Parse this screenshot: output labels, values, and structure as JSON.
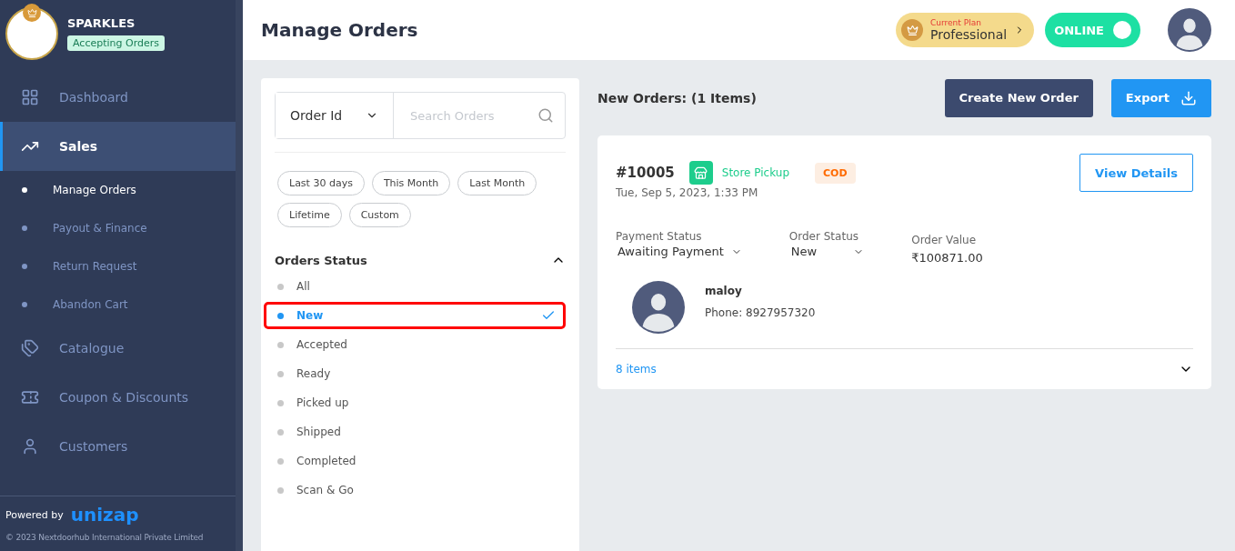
{
  "store": {
    "name": "SPARKLES",
    "status": "Accepting Orders"
  },
  "nav": [
    {
      "label": "Dashboard",
      "kind": "dashboard",
      "selected": false
    },
    {
      "label": "Sales",
      "kind": "chart",
      "selected": true,
      "children": [
        {
          "label": "Manage Orders",
          "selected": true
        },
        {
          "label": "Payout & Finance",
          "selected": false
        },
        {
          "label": "Return Request",
          "selected": false
        },
        {
          "label": "Abandon Cart",
          "selected": false
        }
      ]
    },
    {
      "label": "Catalogue",
      "kind": "tag",
      "selected": false
    },
    {
      "label": "Coupon & Discounts",
      "kind": "coupon",
      "selected": false
    },
    {
      "label": "Customers",
      "kind": "user",
      "selected": false
    }
  ],
  "footer": {
    "powered_by": "Powered by",
    "brand": "unizap",
    "copyright": "© 2023 Nextdoorhub International Private Limited"
  },
  "header": {
    "title": "Manage Orders",
    "plan_label": "Current Plan",
    "plan": "Professional",
    "online": {
      "label": "ONLINE",
      "on": true
    }
  },
  "filters": {
    "search_type": "Order Id",
    "search_placeholder": "Search Orders",
    "date_chips": [
      {
        "label": "Last 30 days",
        "selected": false
      },
      {
        "label": "This Month",
        "selected": false
      },
      {
        "label": "Last Month",
        "selected": false
      },
      {
        "label": "Lifetime",
        "selected": false
      },
      {
        "label": "Custom",
        "selected": false
      }
    ],
    "status_title": "Orders Status",
    "expanded": true,
    "statuses": [
      {
        "label": "All",
        "selected": false,
        "highlighted": false
      },
      {
        "label": "New",
        "selected": true,
        "highlighted": true
      },
      {
        "label": "Accepted",
        "selected": false,
        "highlighted": false
      },
      {
        "label": "Ready",
        "selected": false,
        "highlighted": false
      },
      {
        "label": "Picked up",
        "selected": false,
        "highlighted": false
      },
      {
        "label": "Shipped",
        "selected": false,
        "highlighted": false
      },
      {
        "label": "Completed",
        "selected": false,
        "highlighted": false
      },
      {
        "label": "Scan & Go",
        "selected": false,
        "highlighted": false
      }
    ]
  },
  "orders_title": "New Orders: (1 Items)",
  "create_button": "Create New Order",
  "export_button": "Export",
  "orders": [
    {
      "id": "#10005",
      "delivery": "Store Pickup",
      "payment_type": "COD",
      "date": "Tue, Sep 5, 2023, 1:33 PM",
      "view_button": "View Details",
      "payment_status_label": "Payment Status",
      "payment_status": "Awaiting Payment",
      "order_status_label": "Order Status",
      "order_status": "New",
      "value_label": "Order Value",
      "value": "₹100871.00",
      "customer": "maloy",
      "phone": "Phone: 8927957320",
      "items": "8 items",
      "expanded": false
    }
  ]
}
